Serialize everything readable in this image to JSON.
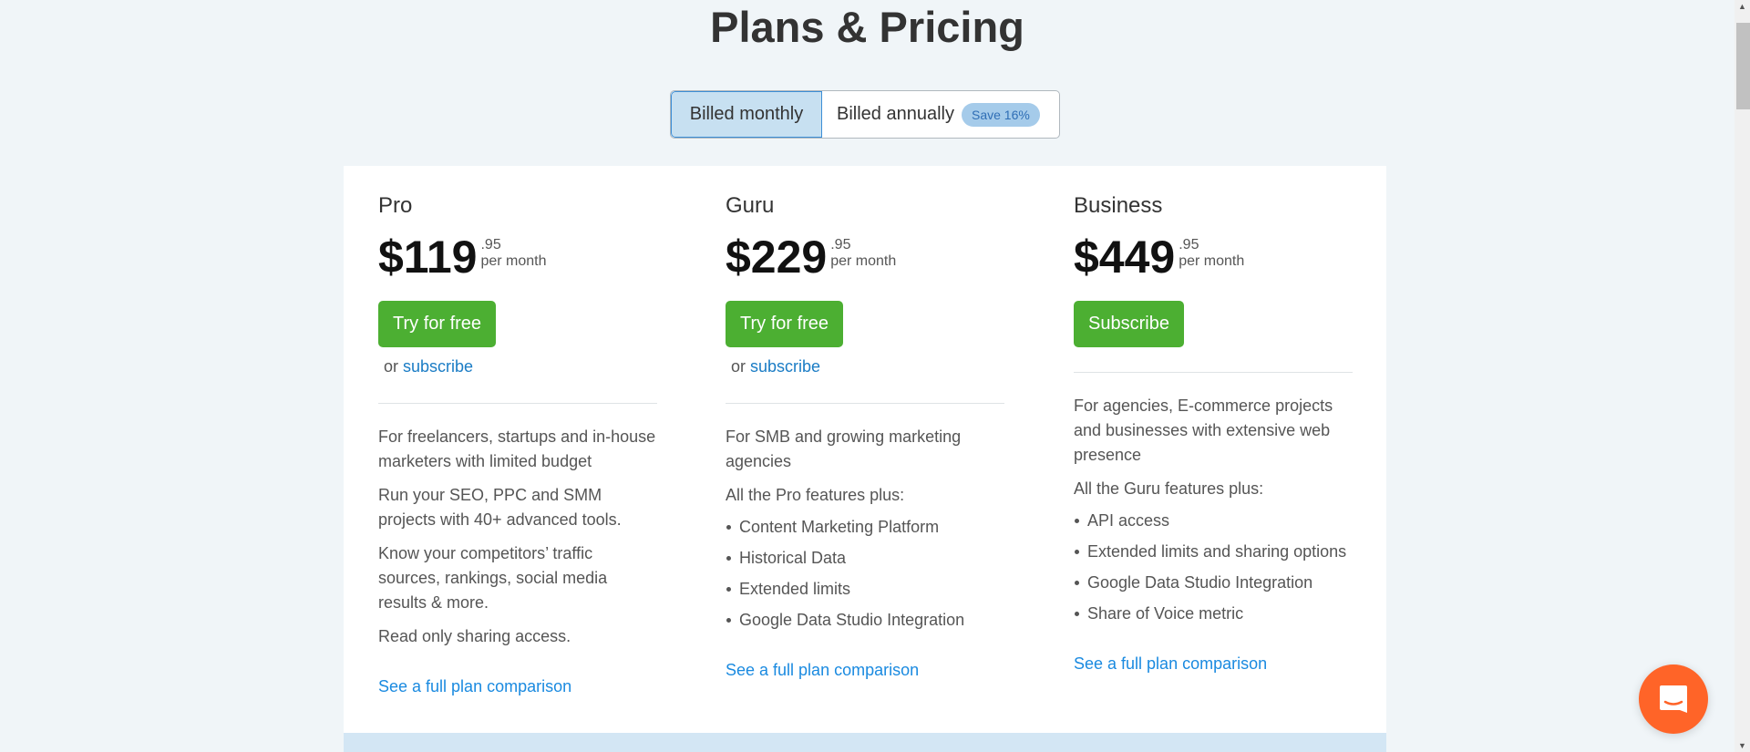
{
  "title": "Plans & Pricing",
  "billing": {
    "monthly": "Billed monthly",
    "annually": "Billed annually",
    "save_badge": "Save 16%",
    "selected": "monthly"
  },
  "plans": [
    {
      "name": "Pro",
      "price": "$119",
      "cents": ".95",
      "period": "per month",
      "button": "Try for free",
      "or": "or",
      "subscribe": "subscribe",
      "paragraphs": [
        "For freelancers, startups and in-house marketers with limited budget",
        "Run your SEO, PPC and SMM projects with 40+ advanced tools.",
        "Know your competitors’ traffic sources, rankings, social media results & more.",
        "Read only sharing access."
      ],
      "features": [],
      "compare": "See a full plan comparison"
    },
    {
      "name": "Guru",
      "price": "$229",
      "cents": ".95",
      "period": "per month",
      "button": "Try for free",
      "or": "or",
      "subscribe": "subscribe",
      "paragraphs": [
        "For SMB and growing marketing agencies",
        "All the Pro features plus:"
      ],
      "features": [
        "Content Marketing Platform",
        "Historical Data",
        "Extended limits",
        "Google Data Studio Integration"
      ],
      "compare": "See a full plan comparison"
    },
    {
      "name": "Business",
      "price": "$449",
      "cents": ".95",
      "period": "per month",
      "button": "Subscribe",
      "paragraphs": [
        "For agencies, E-commerce projects and businesses with extensive web presence",
        "All the Guru features plus:"
      ],
      "features": [
        "API access",
        "Extended limits and sharing options",
        "Google Data Studio Integration",
        "Share of Voice metric"
      ],
      "compare": "See a full plan comparison"
    }
  ],
  "colors": {
    "accent_green": "#4caf32",
    "link": "#1a7cc5",
    "chat": "#ff6428"
  },
  "icons": {
    "chat": "chat-bubble-icon"
  }
}
